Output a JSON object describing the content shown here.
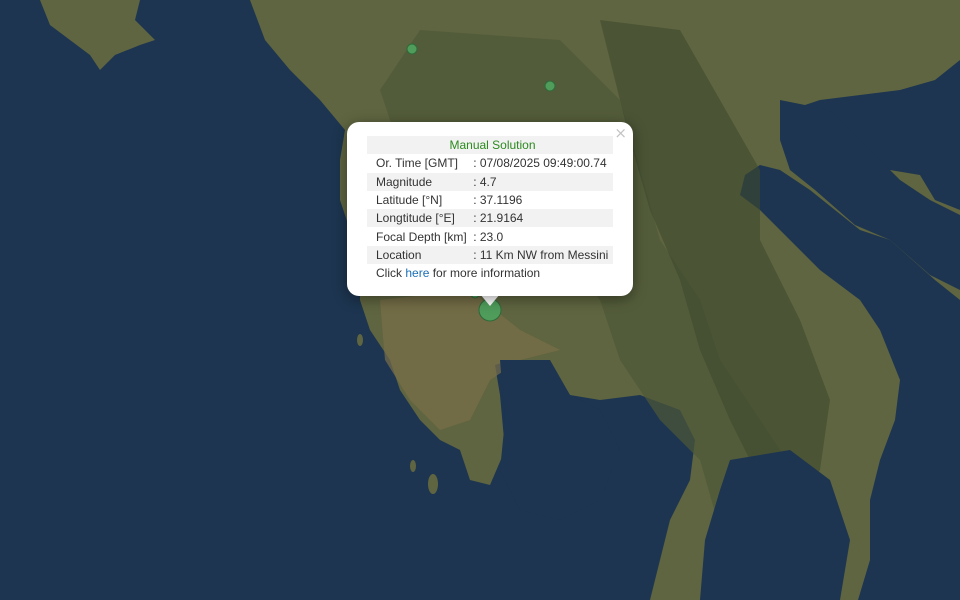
{
  "popup": {
    "title": "Manual Solution",
    "rows": [
      {
        "label": "Or. Time [GMT]",
        "value": ": 07/08/2025 09:49:00.74"
      },
      {
        "label": "Magnitude",
        "value": ": 4.7"
      },
      {
        "label": "Latitude [°N]",
        "value": ": 37.1196"
      },
      {
        "label": "Longtitude [°E]",
        "value": ": 21.9164"
      },
      {
        "label": "Focal Depth [km]",
        "value": ": 23.0"
      },
      {
        "label": "Location",
        "value": ": 11 Km NW from Messini"
      }
    ],
    "info_prefix": "Click ",
    "info_link": "here",
    "info_suffix": " for more information",
    "close_glyph": "×"
  },
  "colors": {
    "sea": "#1d3550",
    "land": "#6b6a43",
    "marker_fill": "#4f9c5b",
    "title_green": "#2c8a1f"
  }
}
